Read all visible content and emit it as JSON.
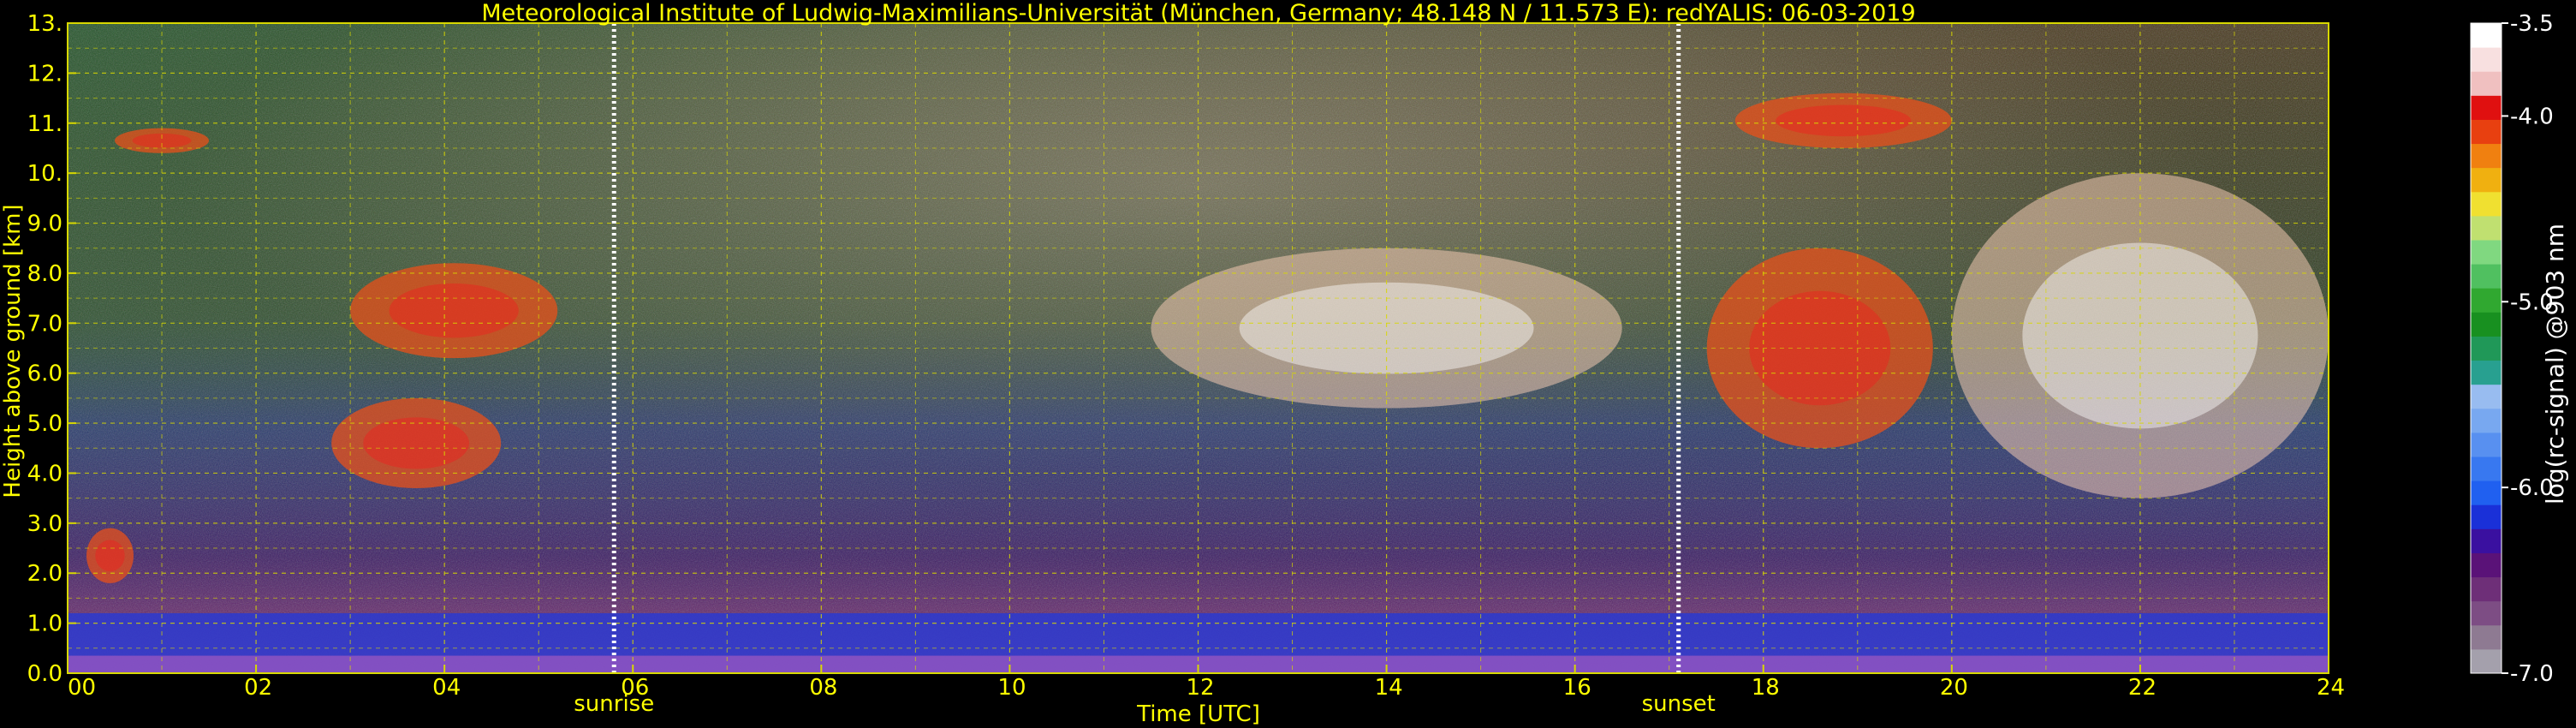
{
  "chart_data": {
    "type": "heatmap",
    "title": "Meteorological Institute of Ludwig-Maximilians-Universität (München, Germany; 48.148 N / 11.573 E):    redYALIS: 06-03-2019",
    "xlabel": "Time [UTC]",
    "ylabel": "Height above ground [km]",
    "xlim": [
      0,
      24
    ],
    "ylim": [
      0,
      13
    ],
    "x_ticks": [
      "00",
      "02",
      "04",
      "06",
      "08",
      "10",
      "12",
      "14",
      "16",
      "18",
      "20",
      "22",
      "24"
    ],
    "x_tick_values": [
      0,
      2,
      4,
      6,
      8,
      10,
      12,
      14,
      16,
      18,
      20,
      22,
      24
    ],
    "y_ticks": [
      "0.0",
      "1.0",
      "2.0",
      "3.0",
      "4.0",
      "5.0",
      "6.0",
      "7.0",
      "8.0",
      "9.0",
      "10.",
      "11.",
      "12.",
      "13."
    ],
    "y_tick_values": [
      0,
      1,
      2,
      3,
      4,
      5,
      6,
      7,
      8,
      9,
      10,
      11,
      12,
      13
    ],
    "grid": true,
    "markers": [
      {
        "label": "sunrise",
        "time": 5.8
      },
      {
        "label": "sunset",
        "time": 17.1
      }
    ],
    "colorbar": {
      "label": "log(rc-signal) @903 nm",
      "range": [
        -7.0,
        -3.5
      ],
      "ticks": [
        "-3.5",
        "-4.0",
        "-5.0",
        "-6.0",
        "-7.0"
      ],
      "tick_values": [
        -3.5,
        -4.0,
        -5.0,
        -6.0,
        -7.0
      ],
      "colors": [
        "#a4a0ac",
        "#8e7a92",
        "#7d4d84",
        "#6e2f78",
        "#5a1278",
        "#3a10a0",
        "#1a30d8",
        "#2060f0",
        "#3878f0",
        "#5890f0",
        "#78a8f0",
        "#98bcf0",
        "#28a090",
        "#209858",
        "#189020",
        "#30a830",
        "#50c060",
        "#80d880",
        "#c0e070",
        "#f0e030",
        "#f0b010",
        "#f08010",
        "#e84010",
        "#e01010",
        "#f0c0c0",
        "#f8e0e0",
        "#ffffff"
      ]
    },
    "features": [
      {
        "type": "boundary-layer",
        "time": [
          0,
          24
        ],
        "height_km": [
          0,
          1.2
        ]
      },
      {
        "type": "cloud",
        "time": [
          2.8,
          4.6
        ],
        "height_km": [
          3.7,
          5.5
        ]
      },
      {
        "type": "cloud",
        "time": [
          3.0,
          5.2
        ],
        "height_km": [
          6.3,
          8.2
        ]
      },
      {
        "type": "cloud",
        "time": [
          0.2,
          0.7
        ],
        "height_km": [
          1.8,
          2.9
        ]
      },
      {
        "type": "cloud",
        "time": [
          0.5,
          1.5
        ],
        "height_km": [
          10.4,
          10.9
        ]
      },
      {
        "type": "cirrus",
        "time": [
          11.5,
          16.5
        ],
        "height_km": [
          5.3,
          8.5
        ]
      },
      {
        "type": "cloud",
        "time": [
          17.4,
          19.8
        ],
        "height_km": [
          4.5,
          8.5
        ]
      },
      {
        "type": "cloud",
        "time": [
          17.7,
          20.0
        ],
        "height_km": [
          10.5,
          11.6
        ]
      },
      {
        "type": "cirrus",
        "time": [
          20.0,
          24.0
        ],
        "height_km": [
          3.5,
          10.0
        ]
      }
    ]
  }
}
